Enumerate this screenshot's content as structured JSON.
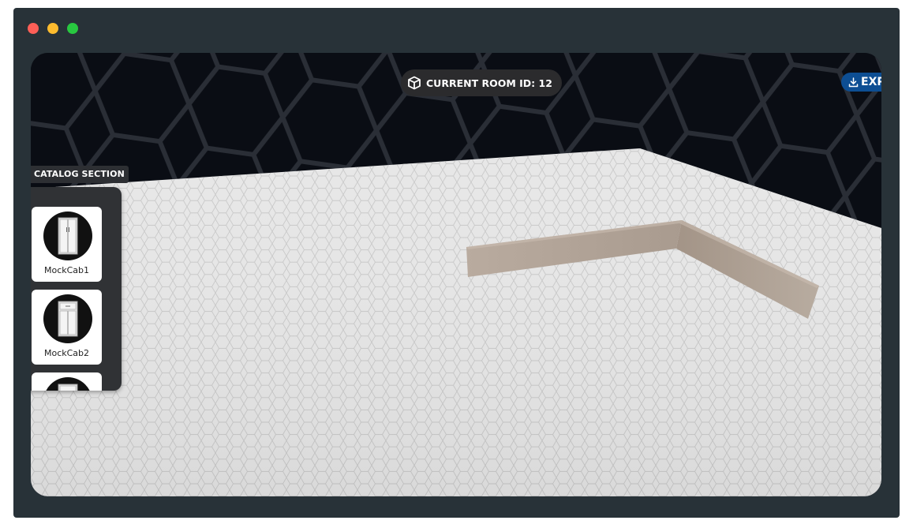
{
  "window": {
    "controls": [
      "close",
      "minimize",
      "maximize"
    ]
  },
  "header": {
    "room_label": "CURRENT ROOM ID: 12",
    "room_icon": "cube-icon",
    "export_label": "EXP",
    "export_icon": "download-icon"
  },
  "catalog": {
    "title": "CATALOG SECTION",
    "items": [
      {
        "name": "MockCab1"
      },
      {
        "name": "MockCab2"
      },
      {
        "name": ""
      }
    ]
  },
  "colors": {
    "window_bg": "#283238",
    "scene_bg": "#0a0d14",
    "floor": "#e6e6e6",
    "wall": "#b3a699",
    "export_button": "#0d4e93",
    "badge_bg": "#2b2b2d"
  }
}
